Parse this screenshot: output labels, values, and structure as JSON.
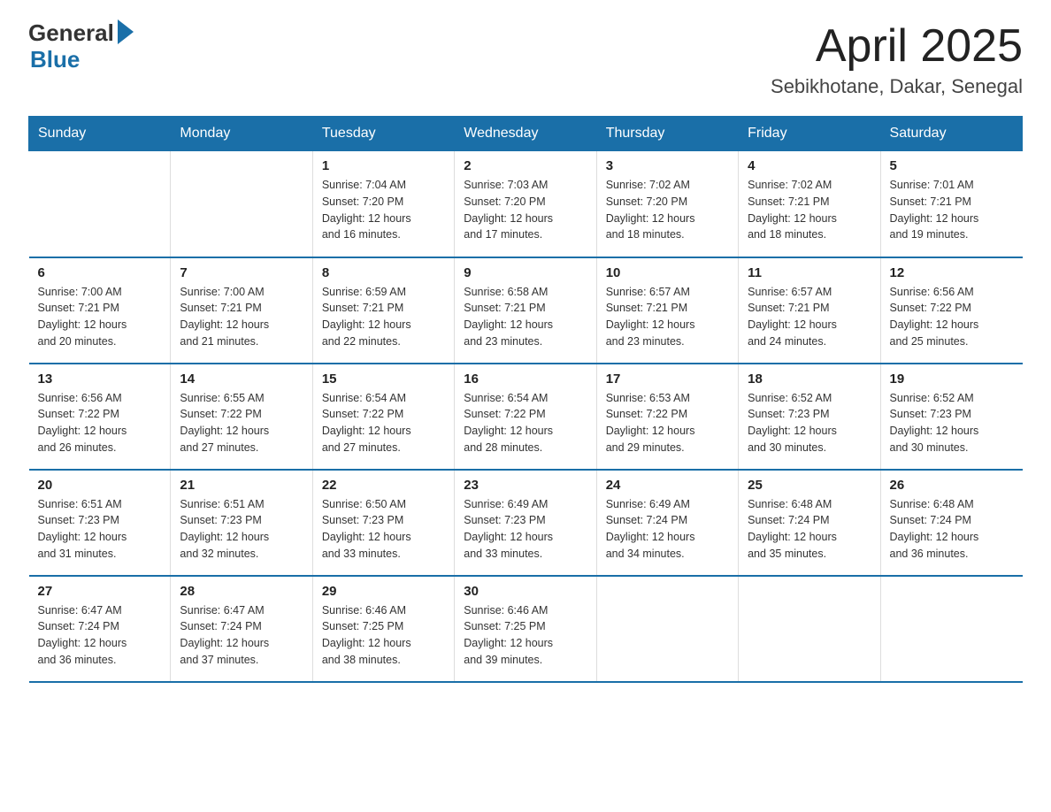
{
  "header": {
    "logo_general": "General",
    "logo_blue": "Blue",
    "month": "April 2025",
    "location": "Sebikhotane, Dakar, Senegal"
  },
  "weekdays": [
    "Sunday",
    "Monday",
    "Tuesday",
    "Wednesday",
    "Thursday",
    "Friday",
    "Saturday"
  ],
  "weeks": [
    [
      {
        "day": "",
        "info": ""
      },
      {
        "day": "",
        "info": ""
      },
      {
        "day": "1",
        "info": "Sunrise: 7:04 AM\nSunset: 7:20 PM\nDaylight: 12 hours\nand 16 minutes."
      },
      {
        "day": "2",
        "info": "Sunrise: 7:03 AM\nSunset: 7:20 PM\nDaylight: 12 hours\nand 17 minutes."
      },
      {
        "day": "3",
        "info": "Sunrise: 7:02 AM\nSunset: 7:20 PM\nDaylight: 12 hours\nand 18 minutes."
      },
      {
        "day": "4",
        "info": "Sunrise: 7:02 AM\nSunset: 7:21 PM\nDaylight: 12 hours\nand 18 minutes."
      },
      {
        "day": "5",
        "info": "Sunrise: 7:01 AM\nSunset: 7:21 PM\nDaylight: 12 hours\nand 19 minutes."
      }
    ],
    [
      {
        "day": "6",
        "info": "Sunrise: 7:00 AM\nSunset: 7:21 PM\nDaylight: 12 hours\nand 20 minutes."
      },
      {
        "day": "7",
        "info": "Sunrise: 7:00 AM\nSunset: 7:21 PM\nDaylight: 12 hours\nand 21 minutes."
      },
      {
        "day": "8",
        "info": "Sunrise: 6:59 AM\nSunset: 7:21 PM\nDaylight: 12 hours\nand 22 minutes."
      },
      {
        "day": "9",
        "info": "Sunrise: 6:58 AM\nSunset: 7:21 PM\nDaylight: 12 hours\nand 23 minutes."
      },
      {
        "day": "10",
        "info": "Sunrise: 6:57 AM\nSunset: 7:21 PM\nDaylight: 12 hours\nand 23 minutes."
      },
      {
        "day": "11",
        "info": "Sunrise: 6:57 AM\nSunset: 7:21 PM\nDaylight: 12 hours\nand 24 minutes."
      },
      {
        "day": "12",
        "info": "Sunrise: 6:56 AM\nSunset: 7:22 PM\nDaylight: 12 hours\nand 25 minutes."
      }
    ],
    [
      {
        "day": "13",
        "info": "Sunrise: 6:56 AM\nSunset: 7:22 PM\nDaylight: 12 hours\nand 26 minutes."
      },
      {
        "day": "14",
        "info": "Sunrise: 6:55 AM\nSunset: 7:22 PM\nDaylight: 12 hours\nand 27 minutes."
      },
      {
        "day": "15",
        "info": "Sunrise: 6:54 AM\nSunset: 7:22 PM\nDaylight: 12 hours\nand 27 minutes."
      },
      {
        "day": "16",
        "info": "Sunrise: 6:54 AM\nSunset: 7:22 PM\nDaylight: 12 hours\nand 28 minutes."
      },
      {
        "day": "17",
        "info": "Sunrise: 6:53 AM\nSunset: 7:22 PM\nDaylight: 12 hours\nand 29 minutes."
      },
      {
        "day": "18",
        "info": "Sunrise: 6:52 AM\nSunset: 7:23 PM\nDaylight: 12 hours\nand 30 minutes."
      },
      {
        "day": "19",
        "info": "Sunrise: 6:52 AM\nSunset: 7:23 PM\nDaylight: 12 hours\nand 30 minutes."
      }
    ],
    [
      {
        "day": "20",
        "info": "Sunrise: 6:51 AM\nSunset: 7:23 PM\nDaylight: 12 hours\nand 31 minutes."
      },
      {
        "day": "21",
        "info": "Sunrise: 6:51 AM\nSunset: 7:23 PM\nDaylight: 12 hours\nand 32 minutes."
      },
      {
        "day": "22",
        "info": "Sunrise: 6:50 AM\nSunset: 7:23 PM\nDaylight: 12 hours\nand 33 minutes."
      },
      {
        "day": "23",
        "info": "Sunrise: 6:49 AM\nSunset: 7:23 PM\nDaylight: 12 hours\nand 33 minutes."
      },
      {
        "day": "24",
        "info": "Sunrise: 6:49 AM\nSunset: 7:24 PM\nDaylight: 12 hours\nand 34 minutes."
      },
      {
        "day": "25",
        "info": "Sunrise: 6:48 AM\nSunset: 7:24 PM\nDaylight: 12 hours\nand 35 minutes."
      },
      {
        "day": "26",
        "info": "Sunrise: 6:48 AM\nSunset: 7:24 PM\nDaylight: 12 hours\nand 36 minutes."
      }
    ],
    [
      {
        "day": "27",
        "info": "Sunrise: 6:47 AM\nSunset: 7:24 PM\nDaylight: 12 hours\nand 36 minutes."
      },
      {
        "day": "28",
        "info": "Sunrise: 6:47 AM\nSunset: 7:24 PM\nDaylight: 12 hours\nand 37 minutes."
      },
      {
        "day": "29",
        "info": "Sunrise: 6:46 AM\nSunset: 7:25 PM\nDaylight: 12 hours\nand 38 minutes."
      },
      {
        "day": "30",
        "info": "Sunrise: 6:46 AM\nSunset: 7:25 PM\nDaylight: 12 hours\nand 39 minutes."
      },
      {
        "day": "",
        "info": ""
      },
      {
        "day": "",
        "info": ""
      },
      {
        "day": "",
        "info": ""
      }
    ]
  ]
}
